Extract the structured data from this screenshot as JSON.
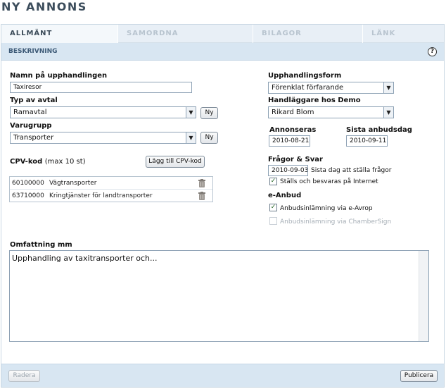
{
  "page": {
    "title": "NY ANNONS"
  },
  "tabs": [
    {
      "label": "ALLMÄNT"
    },
    {
      "label": "SAMORDNA"
    },
    {
      "label": "BILAGOR"
    },
    {
      "label": "LÄNK"
    }
  ],
  "section": {
    "label": "BESKRIVNING",
    "help_icon": "?"
  },
  "form": {
    "name_label": "Namn på upphandlingen",
    "name_value": "Taxiresor",
    "type_label": "Typ av avtal",
    "type_value": "Ramavtal",
    "group_label": "Varugrupp",
    "group_value": "Transporter",
    "new_button": "Ny",
    "cpv_label": "CPV-kod",
    "cpv_hint": "(max 10 st)",
    "add_cpv_button": "Lägg till CPV-kod",
    "cpv_rows": [
      {
        "code": "60100000",
        "desc": "Vägtransporter"
      },
      {
        "code": "63710000",
        "desc": "Kringtjänster för landtransporter"
      }
    ],
    "procurement_label": "Upphandlingsform",
    "procurement_value": "Förenklat förfarande",
    "handler_label": "Handläggare hos Demo",
    "handler_value": "Rikard Blom",
    "advertised_label": "Annonseras",
    "advertised_value": "2010-08-21",
    "deadline_label": "Sista anbudsdag",
    "deadline_value": "2010-09-11",
    "qa_label": "Frågor & Svar",
    "qa_date": "2010-09-03",
    "qa_date_hint": "Sista dag att ställa frågor",
    "qa_internet_label": "Ställs och besvaras på Internet",
    "ebid_label": "e-Anbud",
    "ebid_avrop_label": "Anbudsinlämning via e-Avrop",
    "ebid_chamber_label": "Anbudsinlämning via ChamberSign",
    "scope_label": "Omfattning mm",
    "scope_value": "Upphandling av taxitransporter och..."
  },
  "footer": {
    "delete_button": "Radera",
    "publish_button": "Publicera"
  },
  "icons": {
    "trash": "trash-icon",
    "check": "✓",
    "dropdown": "▼"
  },
  "colors": {
    "accent": "#d8e6f2",
    "title": "#3c4d5c"
  }
}
